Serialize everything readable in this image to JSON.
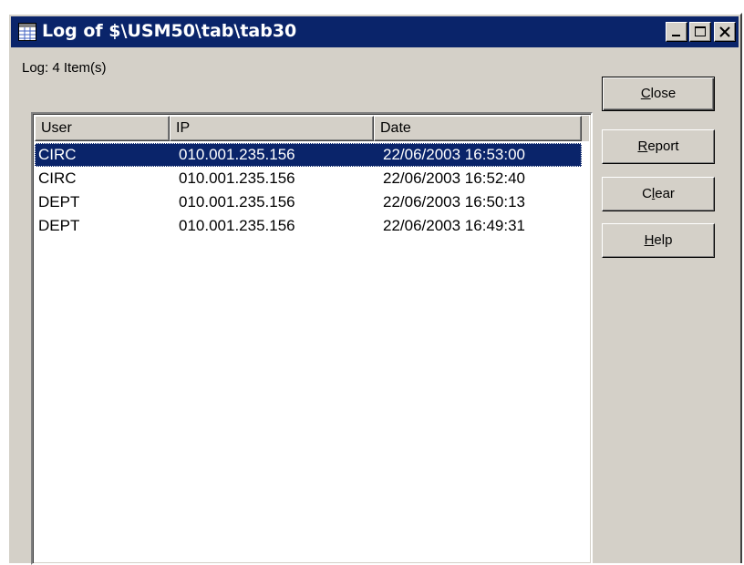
{
  "window": {
    "title": "Log of $\\USM50\\tab\\tab30",
    "controls": [
      {
        "name": "minimize-icon"
      },
      {
        "name": "maximize-icon"
      },
      {
        "name": "close-icon"
      }
    ],
    "app_icon": "log-window-icon"
  },
  "log": {
    "summary": "Log: 4 Item(s)"
  },
  "list": {
    "columns": [
      "User",
      "IP",
      "Date"
    ],
    "rows": [
      {
        "user": "CIRC",
        "ip": "010.001.235.156",
        "date": "22/06/2003 16:53:00",
        "selected": true
      },
      {
        "user": "CIRC",
        "ip": "010.001.235.156",
        "date": "22/06/2003 16:52:40",
        "selected": false
      },
      {
        "user": "DEPT",
        "ip": "010.001.235.156",
        "date": "22/06/2003 16:50:13",
        "selected": false
      },
      {
        "user": "DEPT",
        "ip": "010.001.235.156",
        "date": "22/06/2003 16:49:31",
        "selected": false
      }
    ]
  },
  "buttons": {
    "close": {
      "accel": "C",
      "rest": "lose"
    },
    "report": {
      "accel": "R",
      "rest": "eport"
    },
    "clear": {
      "pre": "C",
      "accel": "l",
      "rest": "ear"
    },
    "help": {
      "accel": "H",
      "rest": "elp"
    }
  },
  "colors": {
    "titlebar": "#0a246a",
    "selection": "#0a246a",
    "face": "#d4d0c8"
  }
}
